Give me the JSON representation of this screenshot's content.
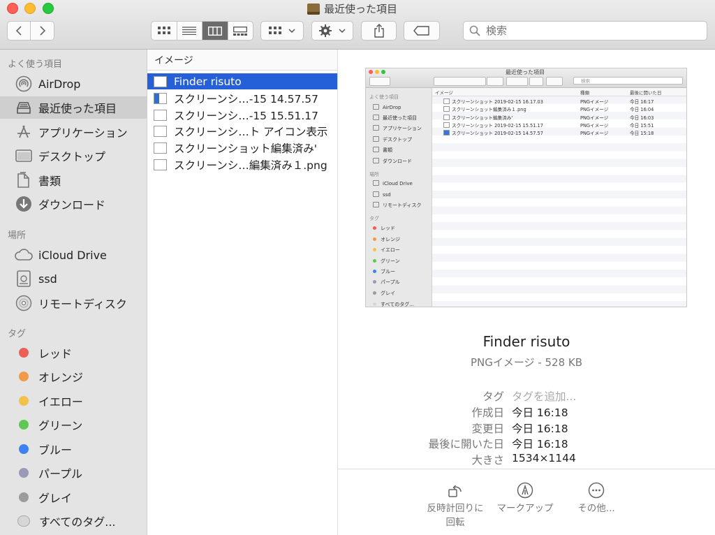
{
  "window": {
    "title": "最近使った項目"
  },
  "search": {
    "placeholder": "検索"
  },
  "sidebar": {
    "favorites_header": "よく使う項目",
    "favorites": [
      {
        "label": "AirDrop",
        "icon": "airdrop-icon"
      },
      {
        "label": "最近使った項目",
        "icon": "recents-icon",
        "selected": true
      },
      {
        "label": "アプリケーション",
        "icon": "applications-icon"
      },
      {
        "label": "デスクトップ",
        "icon": "desktop-icon"
      },
      {
        "label": "書類",
        "icon": "documents-icon"
      },
      {
        "label": "ダウンロード",
        "icon": "downloads-icon"
      }
    ],
    "locations_header": "場所",
    "locations": [
      {
        "label": "iCloud Drive",
        "icon": "cloud-icon"
      },
      {
        "label": "ssd",
        "icon": "drive-icon"
      },
      {
        "label": "リモートディスク",
        "icon": "disc-icon"
      }
    ],
    "tags_header": "タグ",
    "tags": [
      {
        "label": "レッド",
        "color": "#ec5f57"
      },
      {
        "label": "オレンジ",
        "color": "#f19a4a"
      },
      {
        "label": "イエロー",
        "color": "#f2c14b"
      },
      {
        "label": "グリーン",
        "color": "#62c654"
      },
      {
        "label": "ブルー",
        "color": "#3d83f0"
      },
      {
        "label": "パープル",
        "color": "#9a9ab8"
      },
      {
        "label": "グレイ",
        "color": "#9c9c9c"
      },
      {
        "label": "すべてのタグ...",
        "color": "#d6d6d6"
      }
    ]
  },
  "column": {
    "header": "イメージ",
    "files": [
      {
        "label": "Finder risuto",
        "selected": true
      },
      {
        "label": "スクリーンシ…-15 14.57.57",
        "blue": true
      },
      {
        "label": "スクリーンシ…-15 15.51.17"
      },
      {
        "label": "スクリーンシ…ト アイコン表示"
      },
      {
        "label": "スクリーンショット編集済み'"
      },
      {
        "label": "スクリーンシ…編集済み１.png"
      }
    ]
  },
  "preview": {
    "name": "Finder risuto",
    "kind": "PNGイメージ - 528 KB",
    "meta": [
      {
        "label": "タグ",
        "value": "タグを追加...",
        "placeholder": true
      },
      {
        "label": "作成日",
        "value": "今日 16:18"
      },
      {
        "label": "変更日",
        "value": "今日 16:18"
      },
      {
        "label": "最後に開いた日",
        "value": "今日 16:18"
      },
      {
        "label": "大きさ",
        "value": "1534×1144"
      }
    ],
    "actions": [
      {
        "label": "反時計回りに回転",
        "icon": "rotate-left-icon"
      },
      {
        "label": "マークアップ",
        "icon": "markup-icon"
      },
      {
        "label": "その他...",
        "icon": "more-icon"
      }
    ],
    "thumbnail": {
      "title": "最近使った項目",
      "search": "検索",
      "col_headers": [
        "イメージ",
        "種類",
        "最後に開いた日"
      ],
      "sidebar": [
        {
          "label": "よく使う項目",
          "head": true
        },
        {
          "label": "AirDrop"
        },
        {
          "label": "最近使った項目"
        },
        {
          "label": "アプリケーション"
        },
        {
          "label": "デスクトップ"
        },
        {
          "label": "書類"
        },
        {
          "label": "ダウンロード"
        },
        {
          "label": "場所",
          "head": true
        },
        {
          "label": "iCloud Drive"
        },
        {
          "label": "ssd"
        },
        {
          "label": "リモートディスク"
        },
        {
          "label": "タグ",
          "head": true
        },
        {
          "label": "レッド",
          "color": "#ec5f57"
        },
        {
          "label": "オレンジ",
          "color": "#f19a4a"
        },
        {
          "label": "イエロー",
          "color": "#f2c14b"
        },
        {
          "label": "グリーン",
          "color": "#62c654"
        },
        {
          "label": "ブルー",
          "color": "#3d83f0"
        },
        {
          "label": "パープル",
          "color": "#9a9ab8"
        },
        {
          "label": "グレイ",
          "color": "#9c9c9c"
        },
        {
          "label": "すべてのタグ...",
          "color": "#d6d6d6"
        }
      ],
      "rows": [
        {
          "name": "スクリーンショット 2019-02-15 16.17.03",
          "kind": "PNGイメージ",
          "date": "今日 16:17"
        },
        {
          "name": "スクリーンショット編集済み１.png",
          "kind": "PNGイメージ",
          "date": "今日 16:04"
        },
        {
          "name": "スクリーンショット編集済み'",
          "kind": "PNGイメージ",
          "date": "今日 16:03"
        },
        {
          "name": "スクリーンショット 2019-02-15 15.51.17",
          "kind": "PNGイメージ",
          "date": "今日 15:51"
        },
        {
          "name": "スクリーンショット 2019-02-15 14.57.57",
          "kind": "PNGイメージ",
          "date": "今日 15:18"
        }
      ]
    }
  }
}
